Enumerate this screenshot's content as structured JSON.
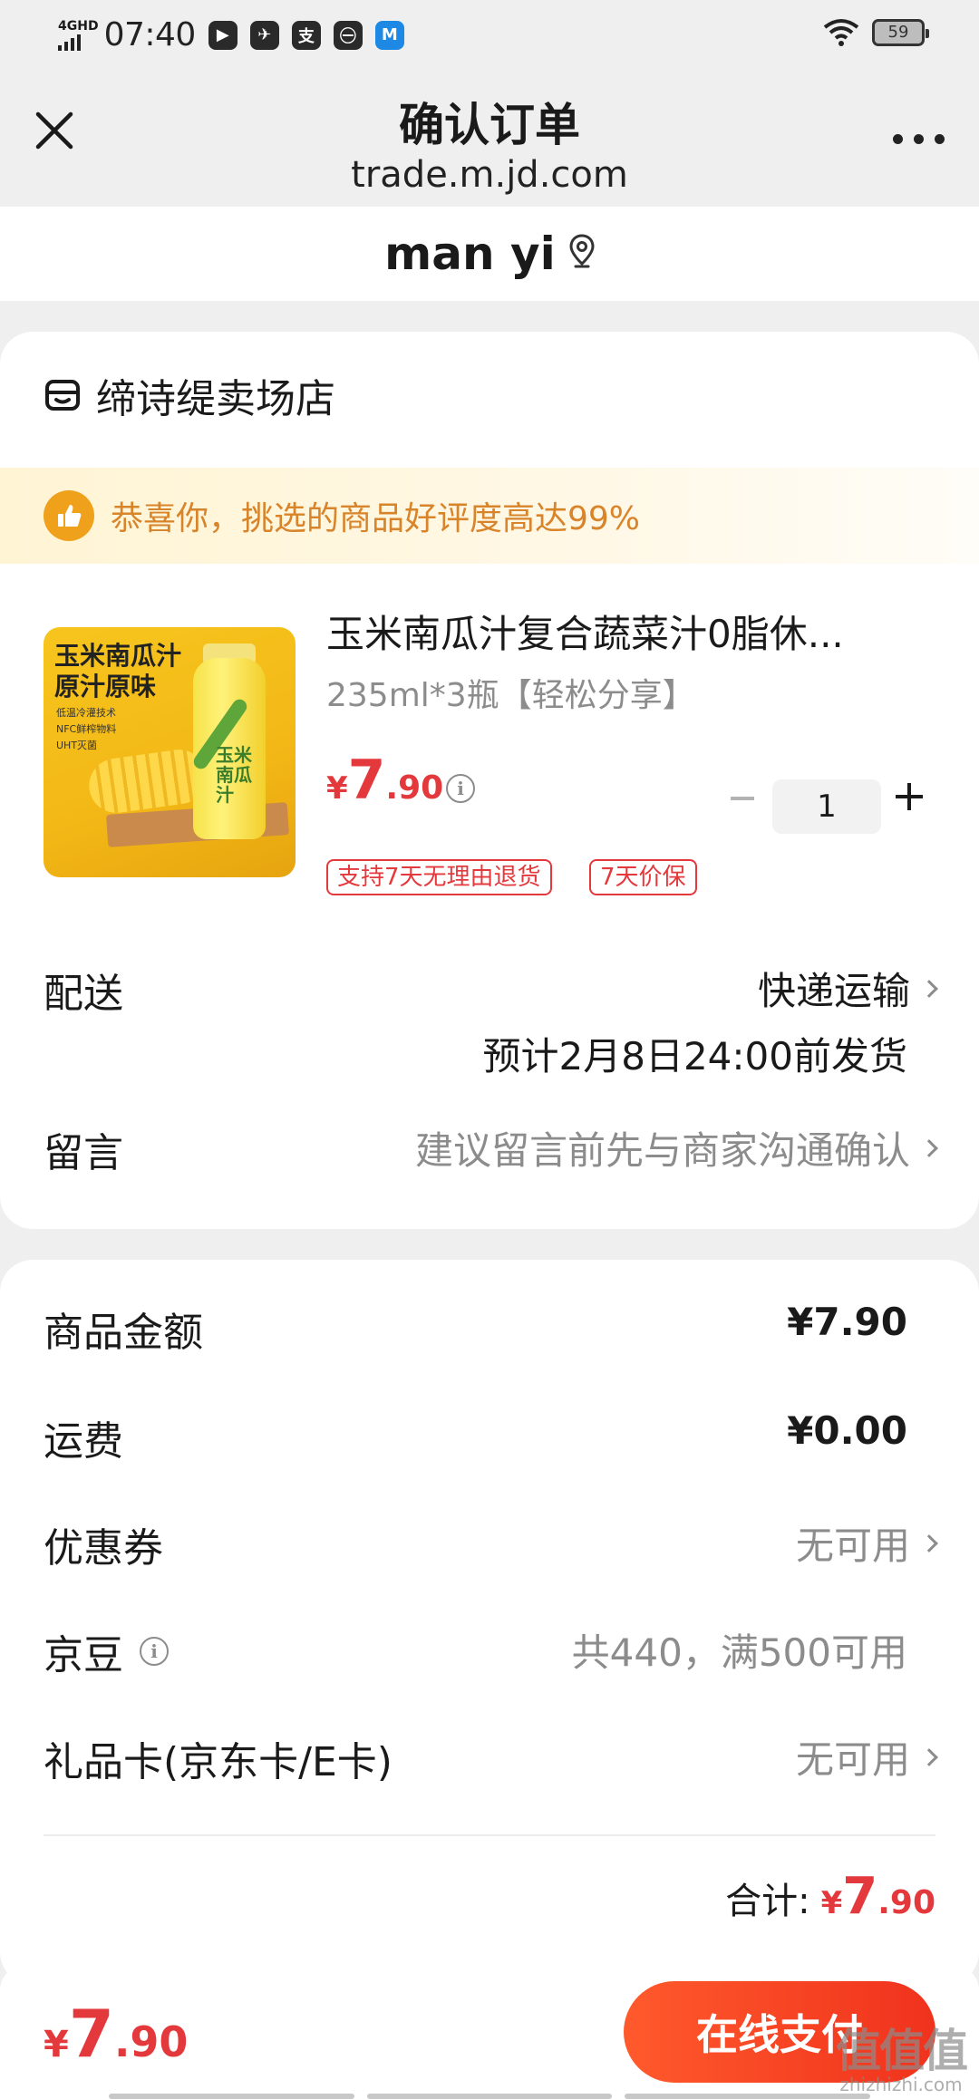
{
  "status_bar": {
    "network": "4GHD",
    "time": "07:40",
    "app_icons": [
      "video-app-icon",
      "bird-app-icon",
      "alipay-app-icon",
      "bank-app-icon",
      "mail-app-icon"
    ],
    "alipay_glyph": "支",
    "bank_glyph": "㊀",
    "battery": "59"
  },
  "nav": {
    "title": "确认订单",
    "url": "trade.m.jd.com"
  },
  "address": {
    "name": "man yi"
  },
  "shop": {
    "name": "缔诗缇卖场店"
  },
  "praise_banner": {
    "text": "恭喜你，挑选的商品好评度高达99%"
  },
  "product": {
    "image": {
      "line1": "玉米南瓜汁",
      "line2": "原汁原味",
      "features": [
        "低温冷灌技术",
        "NFC鲜榨物料",
        "UHT灭菌"
      ],
      "bottle_label": "玉米南瓜汁"
    },
    "name": "玉米南瓜汁复合蔬菜汁0脂休...",
    "spec": "235ml*3瓶【轻松分享】",
    "price_symbol": "¥",
    "price_int": "7",
    "price_dec": ".90",
    "quantity": "1",
    "tags": [
      "支持7天无理由退货",
      "7天价保"
    ]
  },
  "delivery": {
    "label": "配送",
    "method": "快递运输",
    "estimate": "预计2月8日24:00前发货"
  },
  "message": {
    "label": "留言",
    "placeholder": "建议留言前先与商家沟通确认"
  },
  "summary": {
    "goods_amount_label": "商品金额",
    "goods_amount": "¥7.90",
    "shipping_label": "运费",
    "shipping": "¥0.00",
    "coupon_label": "优惠券",
    "coupon": "无可用",
    "jingdou_label": "京豆",
    "jingdou": "共440，满500可用",
    "giftcard_label": "礼品卡(京东卡/E卡)",
    "giftcard": "无可用",
    "total_label": "合计:",
    "total_symbol": "¥",
    "total_int": "7",
    "total_dec": ".90"
  },
  "bottom_bar": {
    "price_symbol": "¥",
    "price_int": "7",
    "price_dec": ".90",
    "pay_label": "在线支付"
  },
  "watermark": {
    "logo": "值值值",
    "url": "zhizhizhi.com"
  },
  "colors": {
    "accent_red": "#e4393c",
    "pay_button": "#f0321d",
    "praise_orange": "#f0a11c"
  }
}
